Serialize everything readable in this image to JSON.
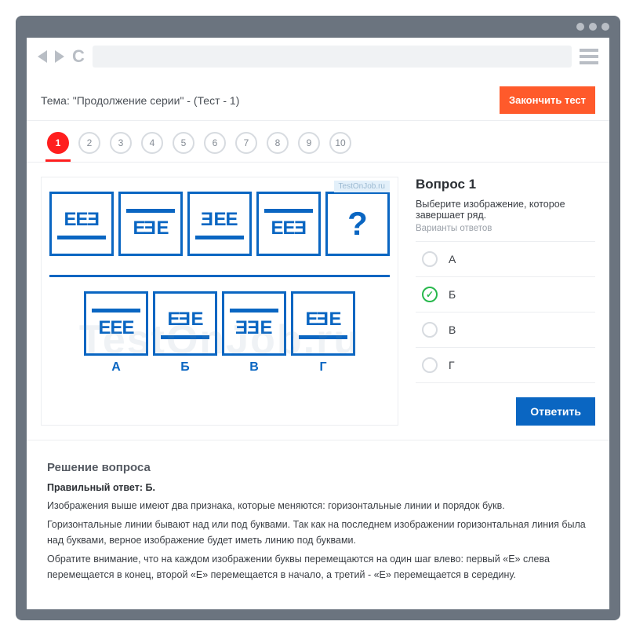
{
  "topic_title": "Тема: \"Продолжение серии\" - (Тест - 1)",
  "finish_label": "Закончить тест",
  "tabs": [
    "1",
    "2",
    "3",
    "4",
    "5",
    "6",
    "7",
    "8",
    "9",
    "10"
  ],
  "active_tab": 0,
  "watermark_small": "TestOnJob.ru",
  "watermark_big": "TestOnJob.ru",
  "series_cells": [
    {
      "bar_pos": "bottom",
      "text": "ЕЕ Е",
      "flips": [
        false,
        false,
        true
      ]
    },
    {
      "bar_pos": "top",
      "text": "Е ЕЕ",
      "flips": [
        false,
        true,
        false
      ]
    },
    {
      "bar_pos": "bottom",
      "text": "ЕЕЕ",
      "flips": [
        true,
        false,
        false
      ]
    },
    {
      "bar_pos": "top",
      "text": "ЕЕ Е",
      "flips": [
        false,
        false,
        true
      ]
    }
  ],
  "qmark": "?",
  "answer_cells": [
    {
      "label": "А",
      "bar_pos": "top",
      "flips": [
        false,
        false,
        false
      ]
    },
    {
      "label": "Б",
      "bar_pos": "bottom",
      "flips": [
        false,
        true,
        false
      ]
    },
    {
      "label": "В",
      "bar_pos": "top",
      "flips": [
        true,
        true,
        false
      ]
    },
    {
      "label": "Г",
      "bar_pos": "bottom",
      "flips": [
        false,
        true,
        false
      ]
    }
  ],
  "question": {
    "title": "Вопрос 1",
    "desc": "Выберите изображение, которое завершает ряд.",
    "sub": "Варианты ответов",
    "options": [
      "А",
      "Б",
      "В",
      "Г"
    ],
    "selected": 1,
    "answer_btn": "Ответить"
  },
  "solution": {
    "heading": "Решение вопроса",
    "correct": "Правильный ответ: Б.",
    "paragraphs": [
      "Изображения выше имеют два признака, которые меняются: горизонтальные линии и порядок букв.",
      "Горизонтальные линии бывают над или под буквами. Так как на последнем изображении горизонтальная линия была над буквами, верное изображение будет иметь линию под буквами.",
      "Обратите внимание, что на каждом изображении буквы перемещаются на один шаг влево: первый «Е» слева перемещается в конец, второй «Е» перемещается в начало, а третий - «Е» перемещается в середину."
    ]
  }
}
